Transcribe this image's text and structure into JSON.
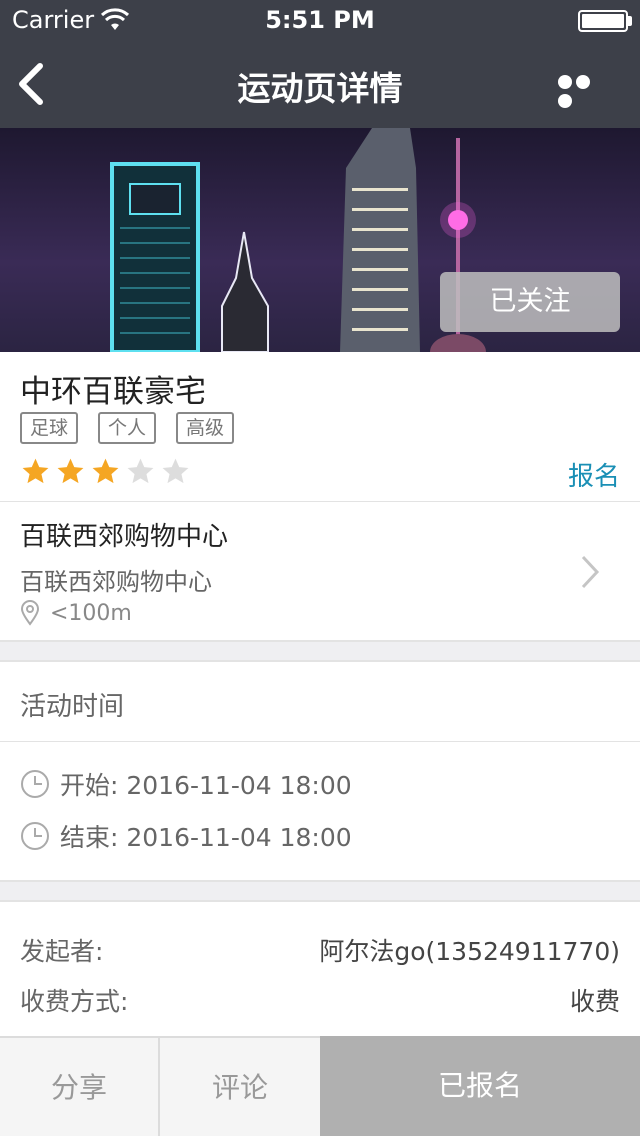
{
  "status": {
    "carrier": "Carrier",
    "time": "5:51 PM"
  },
  "nav": {
    "title": "运动页详情"
  },
  "hero": {
    "follow_label": "已关注"
  },
  "summary": {
    "name": "中环百联豪宅",
    "tags": [
      "足球",
      "个人",
      "高级"
    ],
    "rating": 3,
    "rating_max": 5,
    "signup_link": "报名"
  },
  "location": {
    "name": "百联西郊购物中心",
    "address": "百联西郊购物中心",
    "distance": "<100m"
  },
  "activity_time": {
    "header": "活动时间",
    "start": "开始: 2016-11-04 18:00",
    "end": "结束: 2016-11-04 18:00"
  },
  "info": {
    "organizer_label": "发起者:",
    "organizer_value": "阿尔法go(13524911770)",
    "fee_label": "收费方式:",
    "fee_value": "收费"
  },
  "bottom": {
    "share": "分享",
    "comment": "评论",
    "signed": "已报名"
  },
  "colors": {
    "nav_bg": "#3d4049",
    "accent": "#1a8fb5",
    "star_on": "#f5a623",
    "star_off": "#dddddd"
  }
}
